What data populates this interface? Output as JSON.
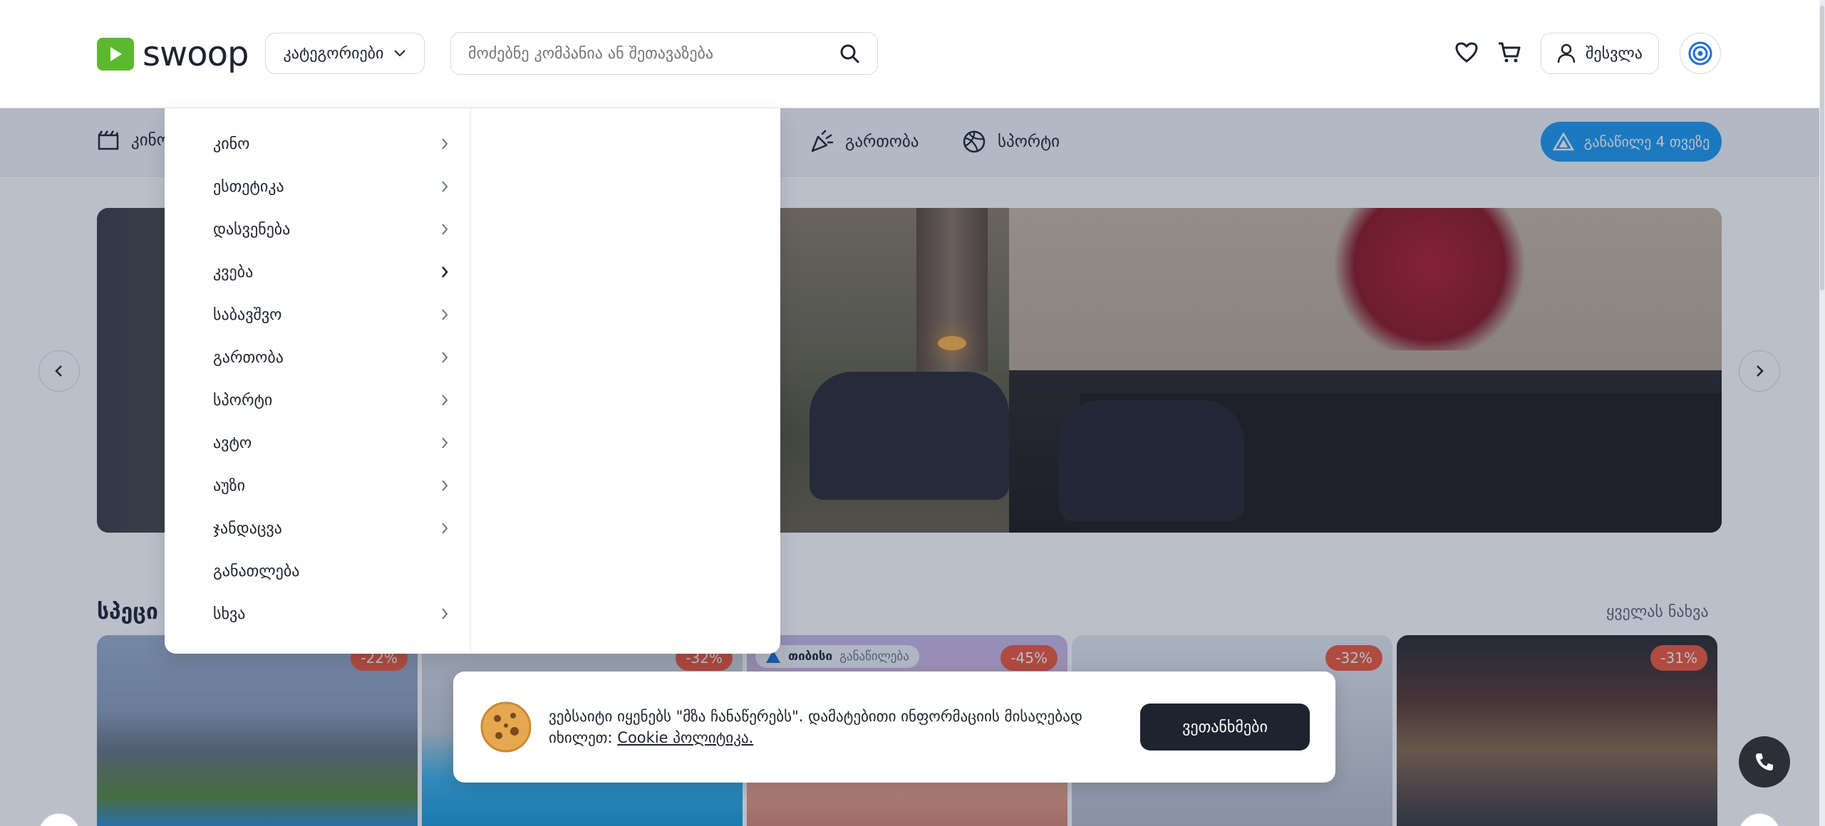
{
  "header": {
    "logo_text": "swoop",
    "categories_label": "კატეგორიები",
    "search_placeholder": "მოძებნე კომპანია ან შეთავაზება",
    "login_label": "შესვლა"
  },
  "navbar": {
    "items": [
      {
        "label": "კინო",
        "icon": "cinema-icon"
      },
      {
        "label": "გართობა",
        "icon": "party-icon"
      },
      {
        "label": "სპორტი",
        "icon": "ball-icon"
      }
    ],
    "installment_label": "განაწილე 4 თვეზე"
  },
  "dropdown": {
    "items": [
      {
        "label": "კინო",
        "has_sub": true
      },
      {
        "label": "ესთეტიკა",
        "has_sub": true
      },
      {
        "label": "დასვენება",
        "has_sub": true
      },
      {
        "label": "კვება",
        "has_sub": true
      },
      {
        "label": "საბავშვო",
        "has_sub": true
      },
      {
        "label": "გართობა",
        "has_sub": true
      },
      {
        "label": "სპორტი",
        "has_sub": true
      },
      {
        "label": "ავტო",
        "has_sub": true
      },
      {
        "label": "აუზი",
        "has_sub": true
      },
      {
        "label": "ჯანდაცვა",
        "has_sub": true
      },
      {
        "label": "განათლება",
        "has_sub": false
      },
      {
        "label": "სხვა",
        "has_sub": true
      }
    ]
  },
  "section": {
    "title": "სპეცი",
    "see_all": "ყველას ნახვა"
  },
  "cards": [
    {
      "discount": "-22%"
    },
    {
      "discount": "-32%"
    },
    {
      "discount": "-45%",
      "tbc_brand": "თიბისი",
      "tbc_label": "განაწილება"
    },
    {
      "discount": "-32%"
    },
    {
      "discount": "-31%"
    }
  ],
  "cookie": {
    "text": "ვებსაიტი იყენებს \"მზა ჩანაწერებს\". დამატებითი ინფორმაციის მისაღებად იხილეთ: ",
    "link": "Cookie პოლიტიკა.",
    "agree_label": "ვეთანხმები"
  },
  "colors": {
    "brand_green": "#5cb82e",
    "installment_blue": "#1d9bf0",
    "discount_red": "#ef5a3c",
    "dark": "#1e2330"
  }
}
